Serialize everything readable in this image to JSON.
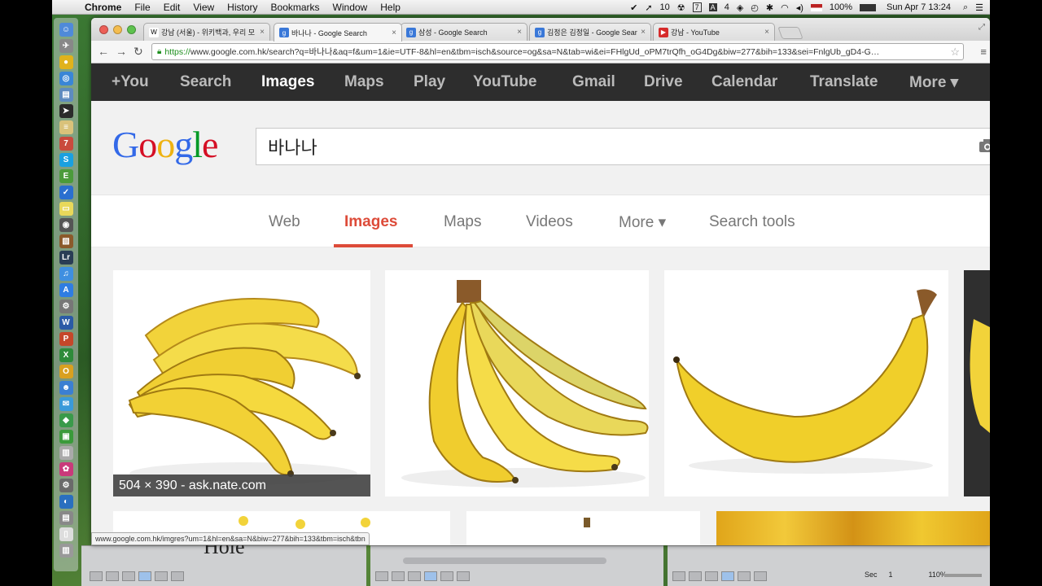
{
  "mac_menubar": {
    "app_name": "Chrome",
    "menus": [
      "File",
      "Edit",
      "View",
      "History",
      "Bookmarks",
      "Window",
      "Help"
    ],
    "status": {
      "count_badge": "10",
      "calendar_day": "7",
      "adobe_count": "4",
      "battery": "100%",
      "datetime": "Sun Apr 7  13:24"
    }
  },
  "dock": {
    "icons": [
      {
        "name": "finder-icon",
        "glyph": "☺",
        "color": "#4f8ad9"
      },
      {
        "name": "launchpad-icon",
        "glyph": "✈",
        "color": "#888"
      },
      {
        "name": "chrome-icon",
        "glyph": "●",
        "color": "#e0b21c"
      },
      {
        "name": "safari-icon",
        "glyph": "◎",
        "color": "#3a86d6"
      },
      {
        "name": "preview-icon",
        "glyph": "▤",
        "color": "#5e8bbf"
      },
      {
        "name": "cursor-icon",
        "glyph": "➤",
        "color": "#2b2b2b"
      },
      {
        "name": "notes-icon",
        "glyph": "≡",
        "color": "#d9c27a"
      },
      {
        "name": "calendar-icon",
        "glyph": "7",
        "color": "#c94a3d"
      },
      {
        "name": "skype-icon",
        "glyph": "S",
        "color": "#1aa0e0"
      },
      {
        "name": "evernote-icon",
        "glyph": "E",
        "color": "#4b9b3a"
      },
      {
        "name": "reminders-icon",
        "glyph": "✓",
        "color": "#2a6fcf"
      },
      {
        "name": "stickies-icon",
        "glyph": "▭",
        "color": "#e8d85a"
      },
      {
        "name": "camera-icon",
        "glyph": "◉",
        "color": "#555"
      },
      {
        "name": "photos-icon",
        "glyph": "▧",
        "color": "#8b5a2b"
      },
      {
        "name": "lightroom-icon",
        "glyph": "Lr",
        "color": "#2a3d55"
      },
      {
        "name": "itunes-icon",
        "glyph": "♫",
        "color": "#3f8fe0"
      },
      {
        "name": "appstore-icon",
        "glyph": "A",
        "color": "#2f7de1"
      },
      {
        "name": "network-icon",
        "glyph": "⚙",
        "color": "#777"
      },
      {
        "name": "word-icon",
        "glyph": "W",
        "color": "#2b5aa6"
      },
      {
        "name": "powerpoint-icon",
        "glyph": "P",
        "color": "#c5472a"
      },
      {
        "name": "excel-icon",
        "glyph": "X",
        "color": "#2e8b3a"
      },
      {
        "name": "outlook-icon",
        "glyph": "O",
        "color": "#d9a020"
      },
      {
        "name": "contacts-icon",
        "glyph": "☻",
        "color": "#3b7fd2"
      },
      {
        "name": "messages-icon",
        "glyph": "✉",
        "color": "#3a9ad9"
      },
      {
        "name": "maps-icon",
        "glyph": "◆",
        "color": "#3a9a4a"
      },
      {
        "name": "facetime-icon",
        "glyph": "▣",
        "color": "#3a9a3a"
      },
      {
        "name": "textedit-icon",
        "glyph": "▥",
        "color": "#aaa"
      },
      {
        "name": "photo-booth-icon",
        "glyph": "✿",
        "color": "#c93a7a"
      },
      {
        "name": "system-prefs-icon",
        "glyph": "⚙",
        "color": "#6a6a6a"
      },
      {
        "name": "safari-compass-icon",
        "glyph": "◐",
        "color": "#2a6fbf"
      },
      {
        "name": "printer-icon",
        "glyph": "▤",
        "color": "#888"
      },
      {
        "name": "document-icon",
        "glyph": "▯",
        "color": "#ddd"
      },
      {
        "name": "trash-icon",
        "glyph": "▥",
        "color": "#999"
      }
    ]
  },
  "browser": {
    "tabs": [
      {
        "favicon": "W",
        "fav_color": "#fff",
        "fav_text": "#000",
        "label": "강남 (서울) - 위키백과, 우리 모",
        "active": false
      },
      {
        "favicon": "g",
        "fav_color": "#3a78d8",
        "fav_text": "#fff",
        "label": "바나나 - Google Search",
        "active": true
      },
      {
        "favicon": "g",
        "fav_color": "#3a78d8",
        "fav_text": "#fff",
        "label": "삼성 - Google Search",
        "active": false
      },
      {
        "favicon": "g",
        "fav_color": "#3a78d8",
        "fav_text": "#fff",
        "label": "김정은 김정일 - Google Searc",
        "active": false
      },
      {
        "favicon": "▶",
        "fav_color": "#d62b2b",
        "fav_text": "#fff",
        "label": "강남 - YouTube",
        "active": false
      }
    ],
    "url_scheme": "https://",
    "url_rest": "www.google.com.hk/search?q=바나나&aq=f&um=1&ie=UTF-8&hl=en&tbm=isch&source=og&sa=N&tab=wi&ei=FHlgUd_oPM7trQfh_oG4Dg&biw=277&bih=133&sei=FnlgUb_gD4-G…",
    "status_url": "www.google.com.hk/imgres?um=1&hl=en&sa=N&biw=277&bih=133&tbm=isch&tbn"
  },
  "google": {
    "bar_items": [
      "+You",
      "Search",
      "Images",
      "Maps",
      "Play",
      "YouTube",
      "Gmail",
      "Drive",
      "Calendar",
      "Translate",
      "More ▾"
    ],
    "bar_selected": "Images",
    "logo_letters": [
      {
        "ch": "G",
        "color": "#3369e8"
      },
      {
        "ch": "o",
        "color": "#d50f25"
      },
      {
        "ch": "o",
        "color": "#eeb211"
      },
      {
        "ch": "g",
        "color": "#3369e8"
      },
      {
        "ch": "l",
        "color": "#009925"
      },
      {
        "ch": "e",
        "color": "#d50f25"
      }
    ],
    "query": "바나나",
    "subnav": {
      "web": "Web",
      "images": "Images",
      "maps": "Maps",
      "videos": "Videos",
      "more": "More ▾",
      "search_tools": "Search tools"
    },
    "results": {
      "first_caption": "504 × 390 - ask.nate.com"
    }
  },
  "background_apps": {
    "page_label": "Sec",
    "page_number": "1",
    "zoom": "110%",
    "partial_word": "Hole"
  },
  "colors": {
    "google_red": "#dd4b39",
    "banana_yellow": "#f2d33a",
    "gbar_dark": "#2d2d2d"
  }
}
